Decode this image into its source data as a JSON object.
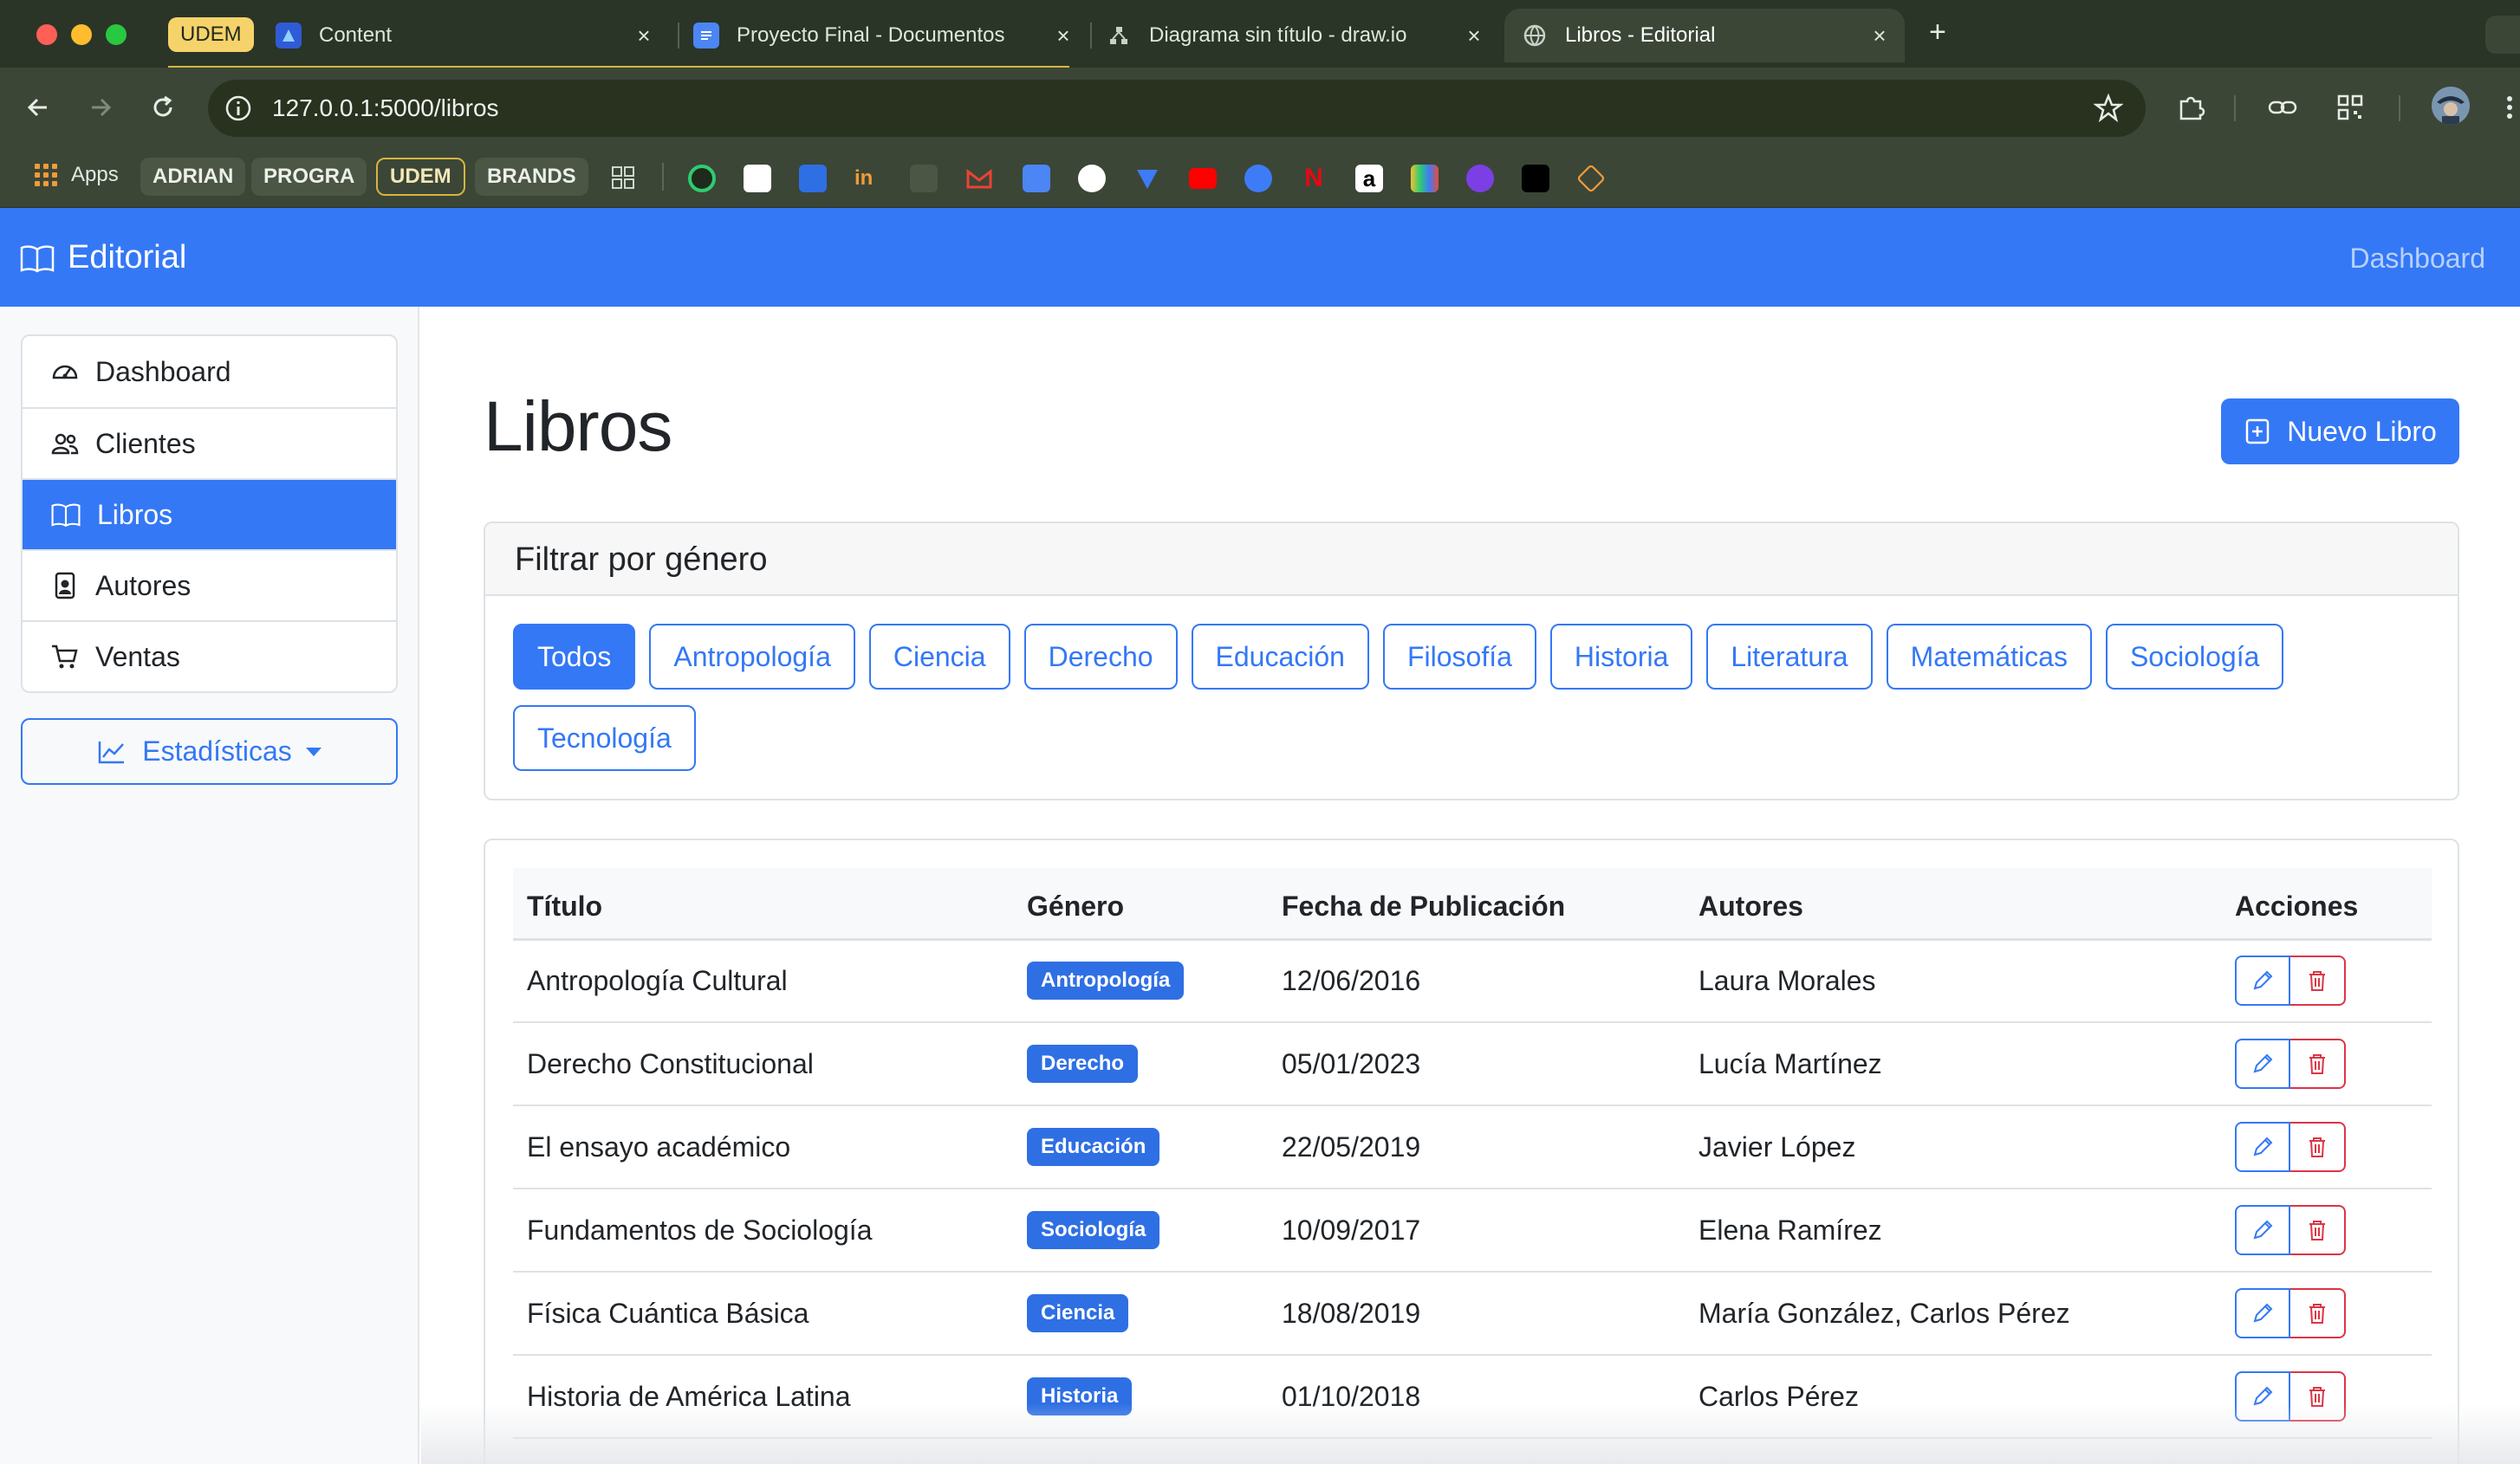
{
  "browser": {
    "tab_group_label": "UDEM",
    "tabs": [
      {
        "title": "Content"
      },
      {
        "title": "Proyecto Final - Documentos"
      },
      {
        "title": "Diagrama sin título - draw.io"
      },
      {
        "title": "Libros - Editorial"
      }
    ],
    "url": "127.0.0.1:5000/libros",
    "bookmarks": {
      "apps_label": "Apps",
      "chips": [
        "ADRIAN",
        "PROGRA",
        "UDEM",
        "BRANDS"
      ]
    }
  },
  "app": {
    "brand": "Editorial",
    "nav_dashboard": "Dashboard"
  },
  "sidebar": {
    "items": [
      {
        "label": "Dashboard",
        "icon": "speedometer-icon"
      },
      {
        "label": "Clientes",
        "icon": "people-icon"
      },
      {
        "label": "Libros",
        "icon": "book-icon"
      },
      {
        "label": "Autores",
        "icon": "person-badge-icon"
      },
      {
        "label": "Ventas",
        "icon": "cart-icon"
      }
    ],
    "stats_label": "Estadísticas"
  },
  "main": {
    "title": "Libros",
    "new_button": "Nuevo Libro",
    "filter": {
      "header": "Filtrar por género",
      "genres": [
        "Todos",
        "Antropología",
        "Ciencia",
        "Derecho",
        "Educación",
        "Filosofía",
        "Historia",
        "Literatura",
        "Matemáticas",
        "Sociología",
        "Tecnología"
      ]
    },
    "table": {
      "headers": [
        "Título",
        "Género",
        "Fecha de Publicación",
        "Autores",
        "Acciones"
      ],
      "rows": [
        {
          "titulo": "Antropología Cultural",
          "genero": "Antropología",
          "fecha": "12/06/2016",
          "autores": "Laura Morales"
        },
        {
          "titulo": "Derecho Constitucional",
          "genero": "Derecho",
          "fecha": "05/01/2023",
          "autores": "Lucía Martínez"
        },
        {
          "titulo": "El ensayo académico",
          "genero": "Educación",
          "fecha": "22/05/2019",
          "autores": "Javier López"
        },
        {
          "titulo": "Fundamentos de Sociología",
          "genero": "Sociología",
          "fecha": "10/09/2017",
          "autores": "Elena Ramírez"
        },
        {
          "titulo": "Física Cuántica Básica",
          "genero": "Ciencia",
          "fecha": "18/08/2019",
          "autores": "María González, Carlos Pérez"
        },
        {
          "titulo": "Historia de América Latina",
          "genero": "Historia",
          "fecha": "01/10/2018",
          "autores": "Carlos Pérez"
        }
      ]
    }
  },
  "colors": {
    "primary": "#3478f6",
    "danger": "#dc3545",
    "browser_frame": "#3b4637"
  }
}
